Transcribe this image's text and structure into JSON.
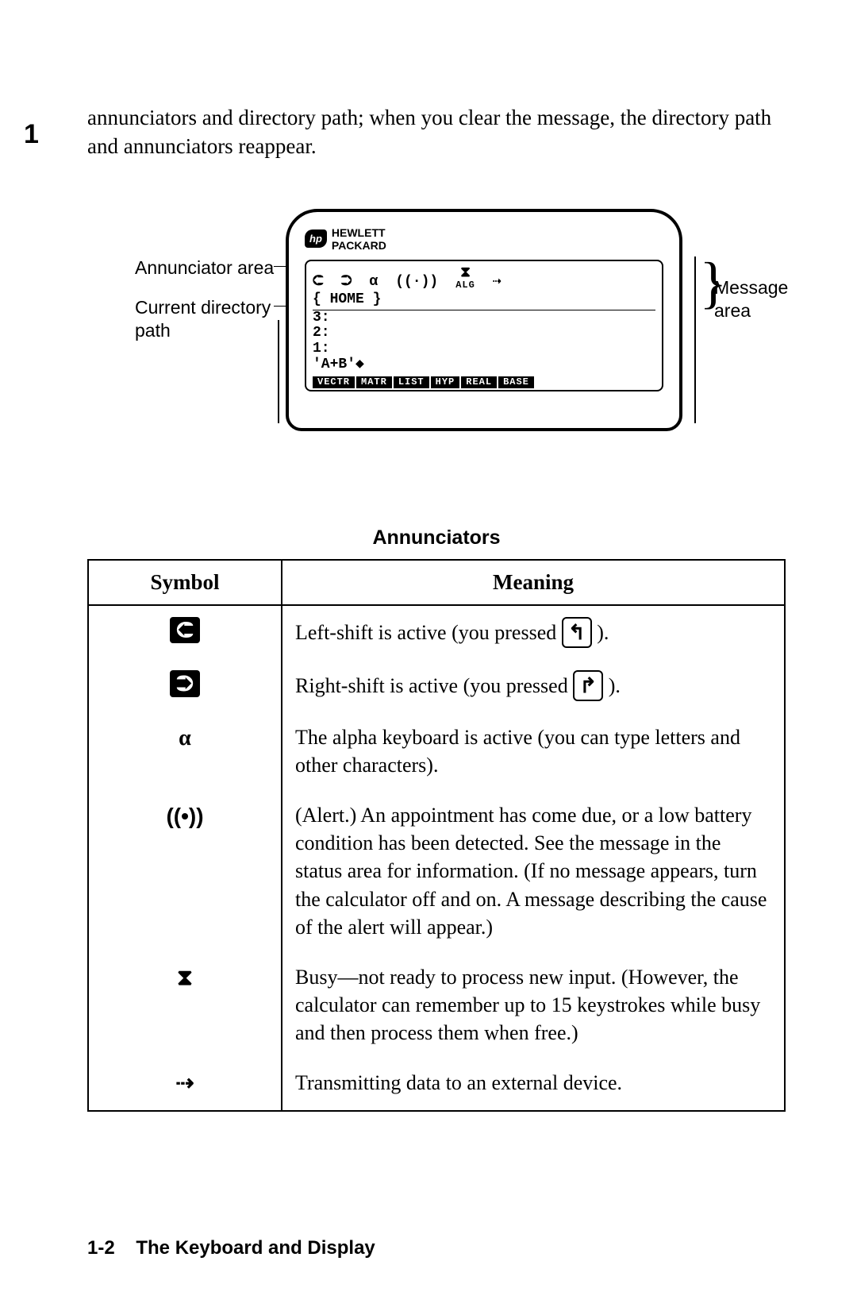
{
  "chapter_number": "1",
  "intro_text": "annunciators and directory path; when you clear the message, the directory path and annunciators reappear.",
  "figure": {
    "brand_top": "HEWLETT",
    "brand_bottom": "PACKARD",
    "brand_badge": "hp",
    "annunciator_icons": {
      "left_shift": "⮈",
      "right_shift": "⮊",
      "alpha": "α",
      "alert": "((·))",
      "busy": "⧗",
      "busy_sub": "ALG",
      "transmit": "⇢"
    },
    "directory_line": "{ HOME }",
    "stack_lines": [
      "3:",
      "2:",
      "1:"
    ],
    "command_line": "'A+B'◆",
    "menu_labels": [
      "VECTR",
      "MATR",
      "LIST",
      "HYP",
      "REAL",
      "BASE"
    ],
    "labels": {
      "annunciator_area": "Annunciator area",
      "current_directory_path": "Current directory path",
      "message_area": "Message area"
    }
  },
  "table": {
    "title": "Annunciators",
    "head_symbol": "Symbol",
    "head_meaning": "Meaning",
    "rows": [
      {
        "symbol_icon": "left-shift-icon",
        "symbol_glyph": "⮈",
        "meaning_pre": "Left-shift is active (you pressed ",
        "key_glyph": "↰",
        "meaning_post": ")."
      },
      {
        "symbol_icon": "right-shift-icon",
        "symbol_glyph": "⮊",
        "meaning_pre": "Right-shift is active (you pressed ",
        "key_glyph": "↱",
        "meaning_post": ")."
      },
      {
        "symbol_icon": "alpha-icon",
        "symbol_glyph": "α",
        "meaning_pre": "The alpha keyboard is active (you can type letters and other characters).",
        "key_glyph": "",
        "meaning_post": ""
      },
      {
        "symbol_icon": "alert-icon",
        "symbol_glyph": "((•))",
        "meaning_pre": "(Alert.) An appointment has come due, or a low battery condition has been detected. See the message in the status area for information. (If no message appears, turn the calculator off and on. A message describing the cause of the alert will appear.)",
        "key_glyph": "",
        "meaning_post": ""
      },
      {
        "symbol_icon": "busy-icon",
        "symbol_glyph": "⧗",
        "meaning_pre": "Busy—not ready to process new input. (However, the calculator can remember up to 15 keystrokes while busy and then process them when free.)",
        "key_glyph": "",
        "meaning_post": ""
      },
      {
        "symbol_icon": "transmit-icon",
        "symbol_glyph": "⇢",
        "meaning_pre": "Transmitting data to an external device.",
        "key_glyph": "",
        "meaning_post": ""
      }
    ]
  },
  "footer": {
    "page_ref": "1-2",
    "section_title": "The Keyboard and Display"
  }
}
